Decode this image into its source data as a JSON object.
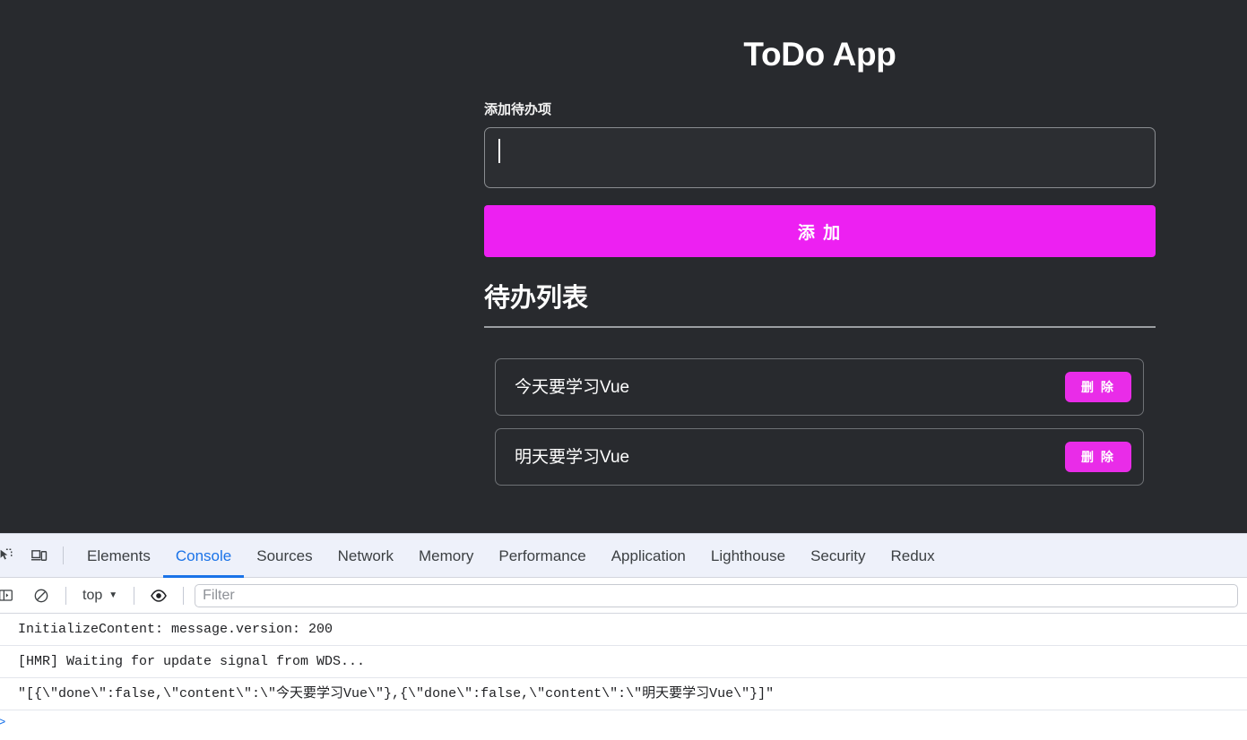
{
  "page": {
    "title": "ToDo App",
    "add_section": {
      "label": "添加待办项",
      "input_value": "",
      "input_placeholder": "",
      "add_button_label": "添 加"
    },
    "list_section": {
      "heading": "待办列表",
      "items": [
        {
          "text": "今天要学习Vue",
          "delete_label": "删 除",
          "done": false
        },
        {
          "text": "明天要学习Vue",
          "delete_label": "删 除",
          "done": false
        }
      ]
    },
    "colors": {
      "background": "#282a2e",
      "accent": "#ed20f2",
      "delete_accent": "#e92ce8",
      "text": "#ffffff",
      "border": "#8a8d91"
    }
  },
  "devtools": {
    "icons": {
      "inspect": "inspect-element-icon",
      "device": "device-toolbar-icon",
      "sidebar": "console-sidebar-icon",
      "clear": "clear-console-icon",
      "eye": "live-expression-icon"
    },
    "tabs": [
      {
        "label": "Elements",
        "active": false
      },
      {
        "label": "Console",
        "active": true
      },
      {
        "label": "Sources",
        "active": false
      },
      {
        "label": "Network",
        "active": false
      },
      {
        "label": "Memory",
        "active": false
      },
      {
        "label": "Performance",
        "active": false
      },
      {
        "label": "Application",
        "active": false
      },
      {
        "label": "Lighthouse",
        "active": false
      },
      {
        "label": "Security",
        "active": false
      },
      {
        "label": "Redux",
        "active": false
      }
    ],
    "console_toolbar": {
      "context": "top",
      "context_caret": "▼",
      "filter_placeholder": "Filter",
      "filter_value": ""
    },
    "console_messages": [
      "InitializeContent: message.version: 200",
      "[HMR] Waiting for update signal from WDS...",
      "\"[{\\\"done\\\":false,\\\"content\\\":\\\"今天要学习Vue\\\"},{\\\"done\\\":false,\\\"content\\\":\\\"明天要学习Vue\\\"}]\""
    ],
    "prompt_symbol": ">"
  }
}
